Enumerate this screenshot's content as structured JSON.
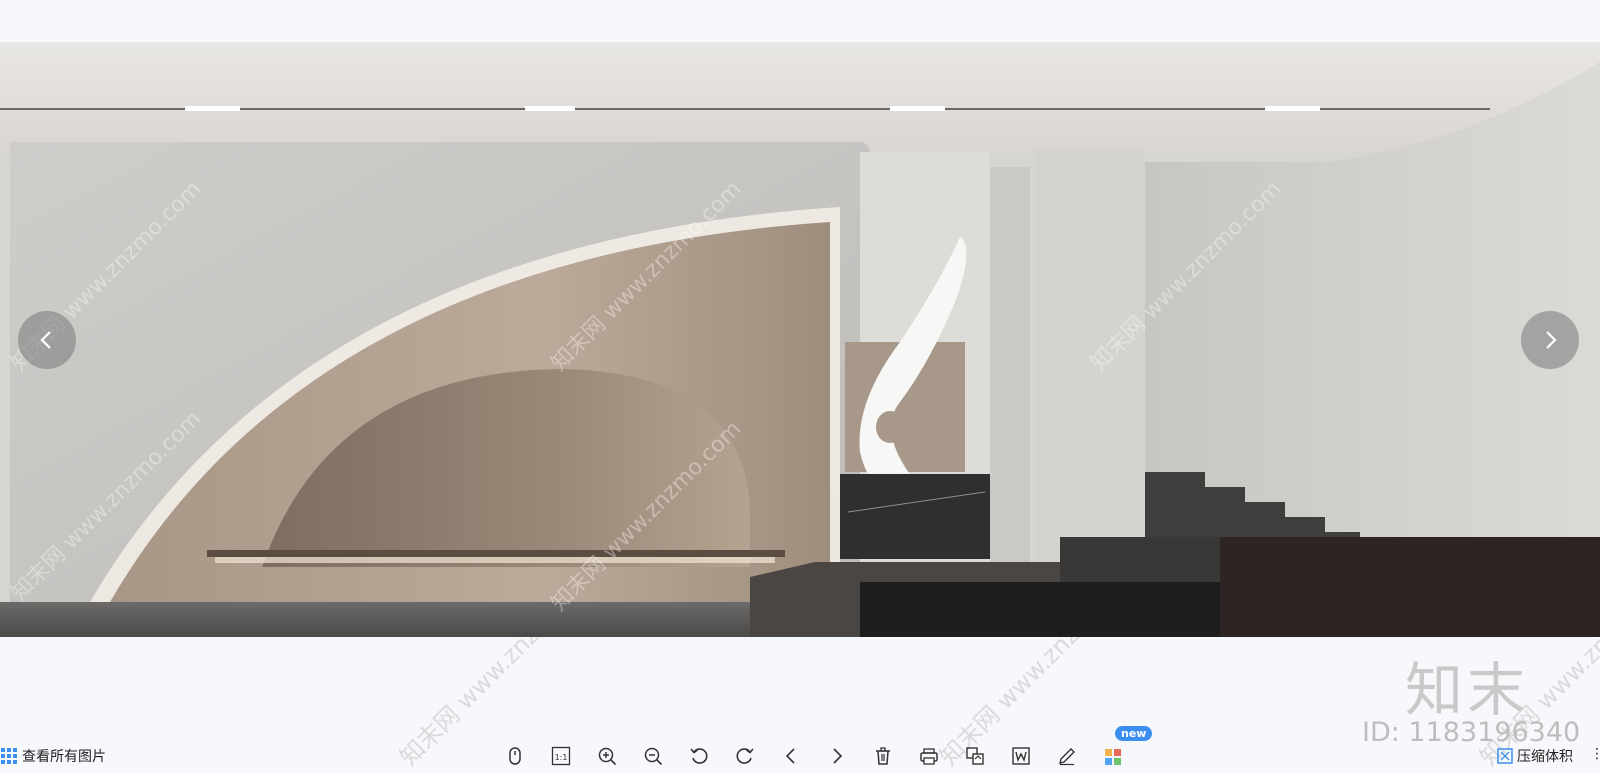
{
  "viewer": {
    "prev_label": "<",
    "next_label": ">"
  },
  "watermark": {
    "logo_text": "知末",
    "id_text": "ID: 1183196340",
    "diagonal_text": "知末网 www.znzmo.com"
  },
  "toolbar": {
    "view_all_label": "查看所有图片",
    "actual_size_label": "1:1",
    "new_badge": "new",
    "compress_label": "压缩体积",
    "more_label": "⋮"
  },
  "tools": [
    {
      "name": "mouse-icon"
    },
    {
      "name": "actual-size-icon"
    },
    {
      "name": "zoom-in-icon"
    },
    {
      "name": "zoom-out-icon"
    },
    {
      "name": "rotate-left-icon"
    },
    {
      "name": "rotate-right-icon"
    },
    {
      "name": "previous-icon"
    },
    {
      "name": "next-icon"
    },
    {
      "name": "delete-icon"
    },
    {
      "name": "print-icon"
    },
    {
      "name": "convert-icon"
    },
    {
      "name": "word-icon"
    },
    {
      "name": "edit-icon"
    },
    {
      "name": "apps-icon"
    }
  ],
  "colors": {
    "background": "#f7f8fc",
    "accent": "#3b8ff1"
  }
}
